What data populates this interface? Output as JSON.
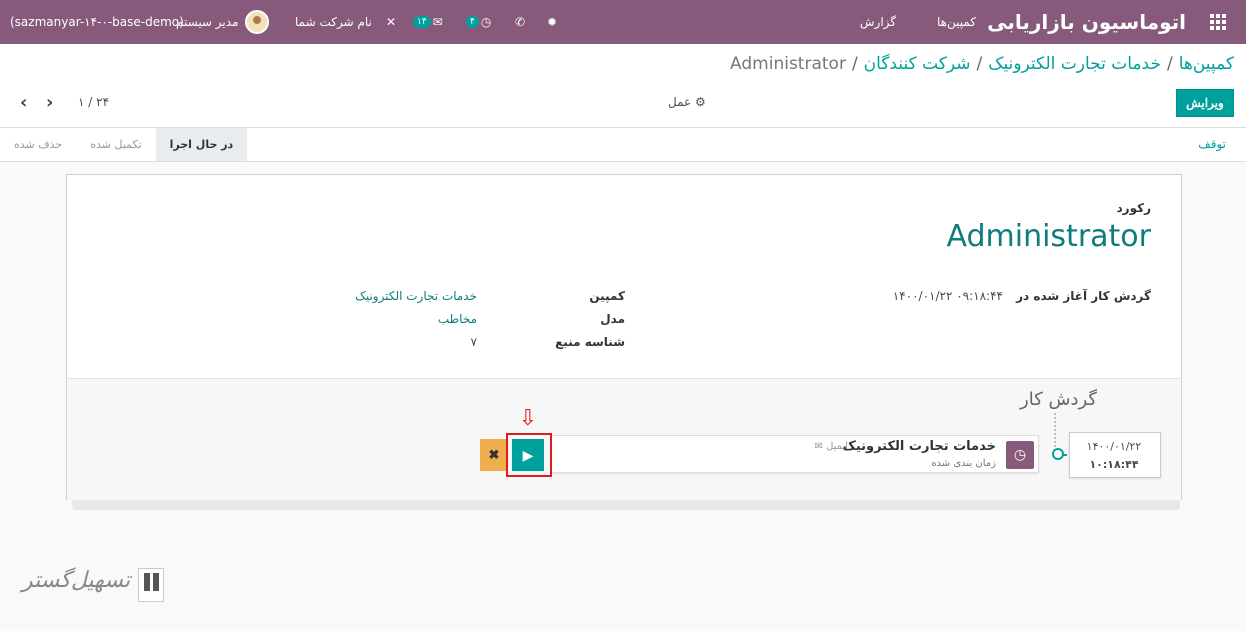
{
  "navbar": {
    "app_title": "اتوماسیون بازاریابی",
    "menu": [
      "کمپین‌ها",
      "گزارش"
    ],
    "activity_badge": "۴",
    "chat_badge": "۱۴",
    "company": "نام شرکت شما",
    "user": "مدیر سیستم",
    "database": "(sazmanyar-۱۴-۰-base-demo)"
  },
  "breadcrumb": {
    "items": [
      "کمپین‌ها",
      "خدمات تجارت الکترونیک",
      "شرکت کنندگان"
    ],
    "current": "Administrator",
    "separator": "/"
  },
  "control": {
    "edit_label": "ویرایش",
    "action_label": "عمل",
    "pager": "۱ / ۲۴"
  },
  "statusbar": {
    "stop_label": "توقف",
    "stages": [
      {
        "label": "در حال اجرا",
        "active": true
      },
      {
        "label": "تکمیل شده",
        "active": false
      },
      {
        "label": "حذف شده",
        "active": false
      }
    ]
  },
  "form": {
    "record_label": "رکورد",
    "record_name": "Administrator",
    "workflow_started_label": "گردش کار آغاز شده در",
    "workflow_started_value": "۱۴۰۰/۰۱/۲۲ ۰۹:۱۸:۴۴",
    "campaign_label": "کمپین",
    "campaign_value": "خدمات تجارت الکترونیک",
    "model_label": "مدل",
    "model_value": "مخاطب",
    "resource_id_label": "شناسه منبع",
    "resource_id_value": "۷"
  },
  "workflow": {
    "title": "گردش کار",
    "date_line1": "۱۴۰۰/۰۱/۲۲",
    "date_line2": "۱۰:۱۸:۴۴",
    "activity_title": "خدمات تجارت الکترونیک",
    "activity_type": "ایمیل",
    "activity_status": "زمان بندی شده"
  },
  "watermark": {
    "text": "تسهیل‌گستر"
  },
  "colors": {
    "navbar": "#875a7b",
    "primary": "#00a09d",
    "cancel": "#f0ad4e",
    "highlight": "#e01b1b"
  }
}
